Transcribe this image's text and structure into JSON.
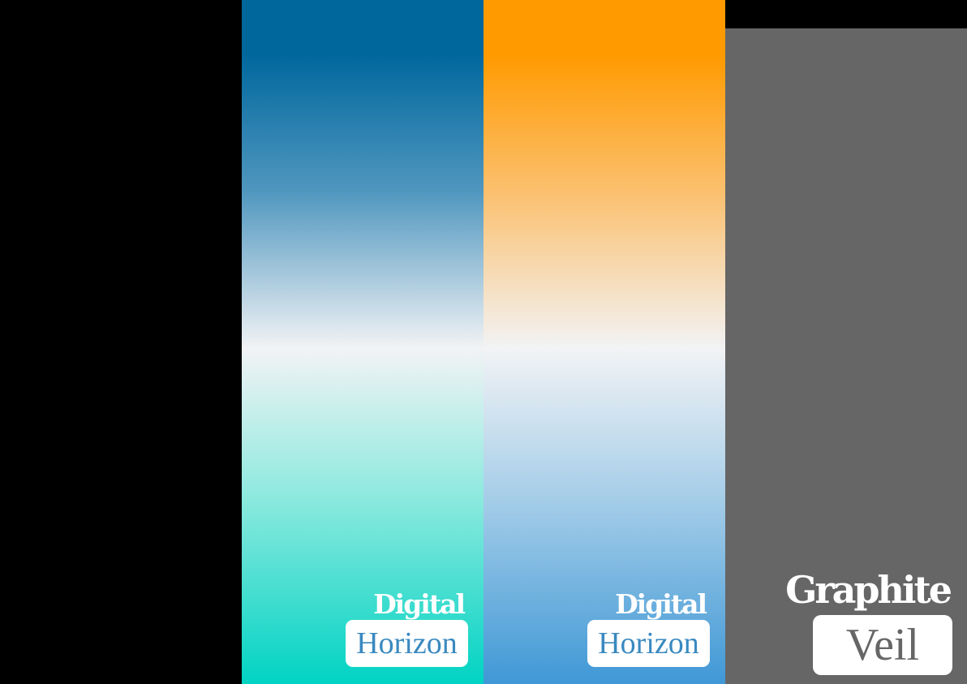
{
  "panels": [
    {
      "background": "#000000"
    },
    {
      "gradient": [
        "#00679d",
        "#5097bf",
        "#f2f3f5",
        "#8be9de",
        "#00d3c3"
      ],
      "logo": {
        "word_top": "Digital",
        "word_box": "Horizon",
        "box_text_color": "#3a89c0",
        "box_bg": "#ffffff"
      }
    },
    {
      "gradient": [
        "#ff9a00",
        "#fbc06e",
        "#f2f3f5",
        "#a5cde8",
        "#3f98d6"
      ],
      "logo": {
        "word_top": "Digital",
        "word_box": "Horizon",
        "box_text_color": "#3a89c0",
        "box_bg": "#ffffff"
      }
    },
    {
      "background": "#666666",
      "logo": {
        "word_top": "Graphite",
        "word_box": "Veil",
        "box_text_color": "#666666",
        "box_bg": "#ffffff"
      }
    }
  ]
}
